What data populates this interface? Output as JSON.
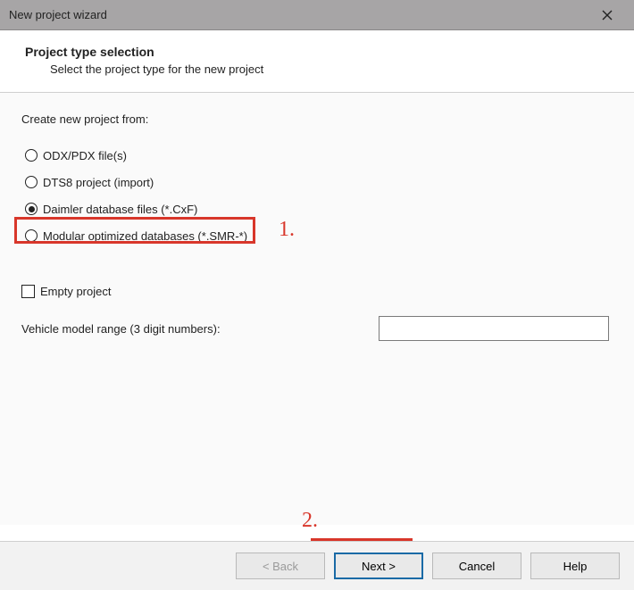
{
  "titlebar": {
    "title": "New project wizard"
  },
  "header": {
    "heading": "Project type selection",
    "sub": "Select the project type for the new project"
  },
  "content": {
    "group_label": "Create new project from:",
    "options": {
      "odx": "ODX/PDX file(s)",
      "dts8": "DTS8 project (import)",
      "daimler": "Daimler database files (*.CxF)",
      "modular": "Modular optimized databases (*.SMR-*)"
    },
    "selected_option": "daimler",
    "empty_project": "Empty project",
    "vehicle_range_label": "Vehicle model range (3 digit numbers):",
    "vehicle_range_value": ""
  },
  "buttons": {
    "back": "< Back",
    "next": "Next >",
    "cancel": "Cancel",
    "help": "Help"
  },
  "annotations": {
    "one": "1.",
    "two": "2."
  }
}
